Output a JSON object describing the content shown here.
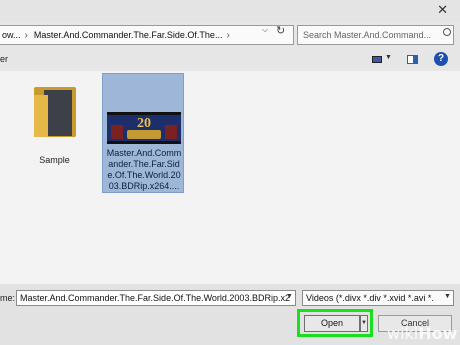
{
  "window": {
    "close_icon": "close-x-icon"
  },
  "address_bar": {
    "breadcrumb": [
      "ow...",
      "Master.And.Commander.The.Far.Side.Of.The..."
    ],
    "search_placeholder": "Search Master.And.Command..."
  },
  "toolbar": {
    "left_text": "er"
  },
  "files": [
    {
      "name": "Sample",
      "type": "folder"
    },
    {
      "name": "Master.And.Commander.The.Far.Side.Of.The.World.2003.BDRip.x264....",
      "type": "video",
      "selected": true
    }
  ],
  "bottom": {
    "filename_label": "me:",
    "filename_value": "Master.And.Commander.The.Far.Side.Of.The.World.2003.BDRip.x2",
    "filetype_value": "Videos (*.divx *.div *.xvid *.avi *.",
    "open_label": "Open",
    "cancel_label": "Cancel"
  },
  "watermark": {
    "part1": "wiki",
    "part2": "How"
  },
  "colors": {
    "highlight": "#18e01c",
    "selection": "#9eb6d8"
  }
}
